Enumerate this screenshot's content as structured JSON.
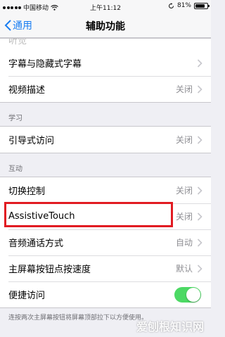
{
  "status_bar": {
    "carrier": "中国移动",
    "time": "上午11:12",
    "battery": "81%",
    "battery_level": 0.81
  },
  "nav": {
    "back_label": "通用",
    "title": "辅助功能"
  },
  "group1": {
    "faded_label": "听觉",
    "rows": [
      {
        "label": "字幕与隐藏式字幕",
        "value": ""
      },
      {
        "label": "视频描述",
        "value": "关闭"
      }
    ]
  },
  "section_learning": {
    "header": "学习",
    "rows": [
      {
        "label": "引导式访问",
        "value": "关闭"
      }
    ]
  },
  "section_interaction": {
    "header": "互动",
    "rows": [
      {
        "label": "切换控制",
        "value": "关闭"
      },
      {
        "label": "AssistiveTouch",
        "value": "关闭"
      },
      {
        "label": "音频通话方式",
        "value": "自动"
      },
      {
        "label": "主屏幕按钮点按速度",
        "value": "默认"
      },
      {
        "label": "便捷访问",
        "toggle": true
      }
    ],
    "footnote": "连按两次主屏幕按钮将屏幕顶部拉下以方便使用。"
  },
  "colors": {
    "accent": "#1a7ef2",
    "toggle_on": "#4cd964",
    "highlight": "#e11b22"
  },
  "watermark": "爱刨根知识网"
}
